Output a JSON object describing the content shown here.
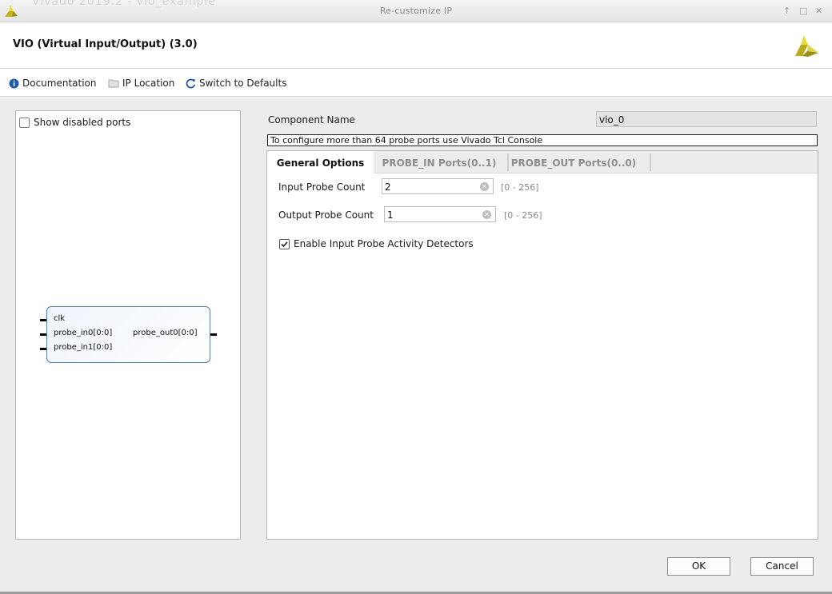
{
  "window": {
    "title": "Re-customize IP",
    "background_text": "Vivado 2019.2 - vio_example",
    "controls": {
      "minimize": "↑",
      "maximize": "□",
      "close": "✕"
    }
  },
  "header": {
    "ip_title": "VIO (Virtual Input/Output) (3.0)",
    "brand_color": "#c8c61a"
  },
  "toolbar": {
    "documentation_label": "Documentation",
    "ip_location_label": "IP Location",
    "switch_defaults_label": "Switch to Defaults"
  },
  "left_panel": {
    "show_disabled_ports_label": "Show disabled ports",
    "show_disabled_ports_checked": false,
    "symbol": {
      "left_ports": [
        "clk",
        "probe_in0[0:0]",
        "probe_in1[0:0]"
      ],
      "right_ports": [
        "probe_out0[0:0]"
      ]
    }
  },
  "right_panel": {
    "component_name_label": "Component Name",
    "component_name_value": "vio_0",
    "note": "To configure more than 64 probe ports use Vivado Tcl Console",
    "tabs": [
      {
        "label": "General Options",
        "active": true
      },
      {
        "label": "PROBE_IN Ports(0..1)",
        "active": false
      },
      {
        "label": "PROBE_OUT Ports(0..0)",
        "active": false
      }
    ],
    "general_options": {
      "input_probe_count_label": "Input  Probe  Count",
      "input_probe_count_value": "2",
      "input_probe_count_range": "[0 - 256]",
      "output_probe_count_label": "Output Probe Count",
      "output_probe_count_value": "1",
      "output_probe_count_range": "[0 - 256]",
      "activity_detectors_label": "Enable Input Probe Activity Detectors",
      "activity_detectors_checked": true
    }
  },
  "footer": {
    "ok_label": "OK",
    "cancel_label": "Cancel"
  }
}
